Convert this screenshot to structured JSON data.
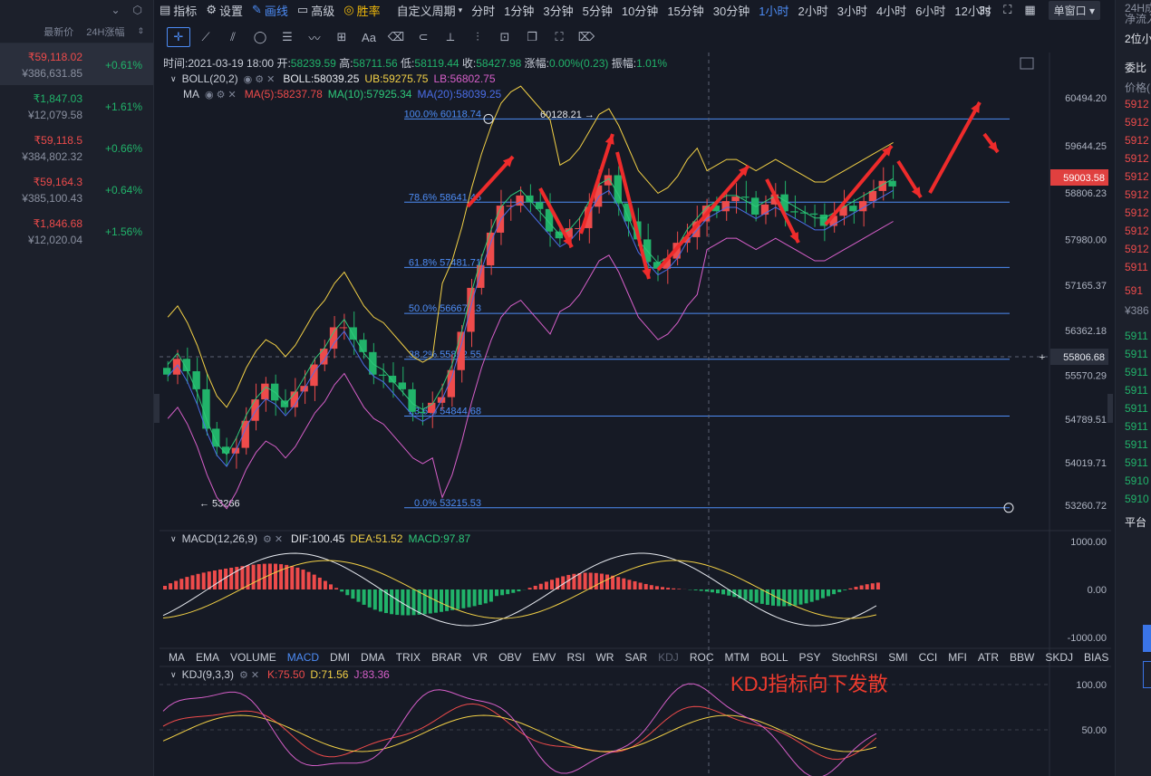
{
  "left": {
    "top_icons": [
      "chevron-down-icon",
      "settings-hex-icon"
    ],
    "header": {
      "price_col": "最新价",
      "change_col": "24H涨幅"
    },
    "tickers": [
      {
        "price": "₹59,118.02",
        "cny": "¥386,631.85",
        "change": "+0.61%",
        "price_color": "red",
        "active": true
      },
      {
        "price": "₹1,847.03",
        "cny": "¥12,079.58",
        "change": "+1.61%",
        "price_color": "green",
        "active": false
      },
      {
        "price": "₹59,118.5",
        "cny": "¥384,802.32",
        "change": "+0.66%",
        "price_color": "red",
        "active": false
      },
      {
        "price": "₹59,164.3",
        "cny": "¥385,100.43",
        "change": "+0.64%",
        "price_color": "red",
        "active": false
      },
      {
        "price": "₹1,846.68",
        "cny": "¥12,020.04",
        "change": "+1.56%",
        "price_color": "red",
        "active": false
      }
    ]
  },
  "toolbar": {
    "indicators": "指标",
    "settings": "设置",
    "draw": "画线",
    "advanced": "高级",
    "winrate": "胜率",
    "custom_period": "自定义周期",
    "periods": [
      "分时",
      "1分钟",
      "3分钟",
      "5分钟",
      "10分钟",
      "15分钟",
      "30分钟",
      "1小时",
      "2小时",
      "3小时",
      "4小时",
      "6小时",
      "12小时"
    ],
    "active_period": "1小时",
    "interval": "3s",
    "window_mode": "单窗口"
  },
  "draw_tools": [
    "crosshair-icon",
    "line-icon",
    "channel-icon",
    "circle-icon",
    "hlines-icon",
    "wave-icon",
    "grid-plus-icon",
    "text-icon",
    "eraser-icon",
    "magnet-icon",
    "ruler-icon",
    "slider-icon",
    "lock-icon",
    "copy-icon",
    "screenshot-icon",
    "trash-icon"
  ],
  "draw_text_tool": "Aa",
  "info": {
    "time_label": "时间:",
    "time": "2021-03-19 18:00",
    "open_label": "开:",
    "open": "58239.59",
    "high_label": "高:",
    "high": "58711.56",
    "low_label": "低:",
    "low": "58119.44",
    "close_label": "收:",
    "close": "58427.98",
    "change_label": "涨幅:",
    "change": "0.00%(0.23)",
    "amp_label": "振幅:",
    "amp": "1.01%"
  },
  "boll": {
    "name": "BOLL(20,2)",
    "mid": "BOLL:58039.25",
    "ub": "UB:59275.75",
    "lb": "LB:56802.75"
  },
  "ma": {
    "name": "MA",
    "ma5": "MA(5):58237.78",
    "ma10": "MA(10):57925.34",
    "ma20": "MA(20):58039.25"
  },
  "macd": {
    "name": "MACD(12,26,9)",
    "dif": "DIF:100.45",
    "dea": "DEA:51.52",
    "macd": "MACD:97.87",
    "axis": [
      "1000.00",
      "0.00",
      "-1000.00"
    ]
  },
  "kdj": {
    "name": "KDJ(9,3,3)",
    "k": "K:75.50",
    "d": "D:71.56",
    "j": "J:83.36",
    "axis": [
      "100.00",
      "50.00"
    ]
  },
  "kdj_note": "KDJ指标向下发散",
  "price_axis": [
    "60494.20",
    "59644.25",
    "58806.23",
    "57980.00",
    "57165.37",
    "56362.18",
    "55570.29",
    "54789.51",
    "54019.71",
    "53260.72"
  ],
  "current_price": "59003.58",
  "crosshair_price": "55806.68",
  "fib_levels": [
    {
      "label": "100.0% 60118.74",
      "value": 60118.74
    },
    {
      "label": "78.6% 58641.45",
      "value": 58641.45
    },
    {
      "label": "61.8% 57481.71",
      "value": 57481.71
    },
    {
      "label": "50.0% 56667.13",
      "value": 56667.13
    },
    {
      "label": "38.2% 55852.55",
      "value": 55852.55
    },
    {
      "label": "23.6% 54844.68",
      "value": 54844.68
    },
    {
      "label": "0.0% 53215.53",
      "value": 53215.53
    }
  ],
  "high_marker": "60128.21 →",
  "low_marker": "← 53266",
  "indicator_tabs": [
    "MA",
    "EMA",
    "VOLUME",
    "MACD",
    "DMI",
    "DMA",
    "TRIX",
    "BRAR",
    "VR",
    "OBV",
    "EMV",
    "RSI",
    "WR",
    "SAR",
    "KDJ",
    "ROC",
    "MTM",
    "BOLL",
    "PSY",
    "StochRSI",
    "SMI",
    "CCI",
    "MFI",
    "ATR",
    "BBW",
    "SKDJ",
    "BIAS"
  ],
  "active_indicator_tab": "MACD",
  "dim_indicator_tab": "KDJ",
  "right": {
    "top1": "24H成",
    "top2": "净流入",
    "depth": "2位小",
    "tab": "委比",
    "price_hdr": "价格(",
    "asks": [
      "5912",
      "5912",
      "5912",
      "5912",
      "5912",
      "5912",
      "5912",
      "5912",
      "5912",
      "5911"
    ],
    "last": "591",
    "last_cny": "¥386",
    "bids": [
      "5911",
      "5911",
      "5911",
      "5911",
      "5911",
      "5911",
      "5911",
      "5911",
      "5910",
      "5910"
    ],
    "platform": "平台"
  },
  "colors": {
    "up": "#ee4b4b",
    "down": "#21b36a",
    "accent": "#4d8cf5",
    "fib": "#4d8cf5",
    "arrow": "#ee2b2b"
  }
}
